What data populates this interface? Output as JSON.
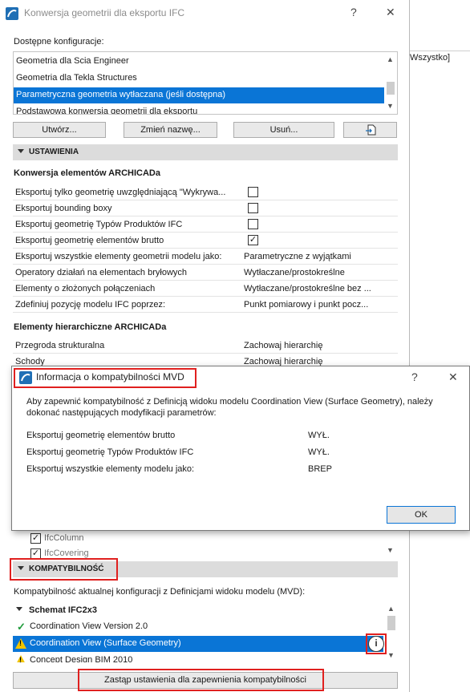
{
  "background": {
    "partial_text": "Wszystko]"
  },
  "window": {
    "title": "Konwersja geometrii dla eksportu IFC",
    "help_glyph": "?",
    "close_glyph": "✕"
  },
  "configs": {
    "label": "Dostępne konfiguracje:",
    "items": [
      "Geometria dla Scia Engineer",
      "Geometria dla Tekla Structures",
      "Parametryczna geometria wytłaczana (jeśli dostępna)",
      "Podstawowa konwersja geometrii dla eksportu"
    ],
    "selected_index": 2,
    "buttons": {
      "create": "Utwórz...",
      "rename": "Zmień nazwę...",
      "delete": "Usuń..."
    }
  },
  "settings": {
    "header": "USTAWIENIA",
    "conv_header": "Konwersja elementów ARCHICADa",
    "rows": [
      {
        "label": "Eksportuj tylko geometrię uwzględniającą \"Wykrywa...",
        "checked": false
      },
      {
        "label": "Eksportuj bounding boxy",
        "checked": false
      },
      {
        "label": "Eksportuj geometrię Typów Produktów IFC",
        "checked": false
      },
      {
        "label": "Eksportuj geometrię elementów brutto",
        "checked": true
      },
      {
        "label": "Eksportuj wszystkie elementy geometrii modelu jako:",
        "value": "Parametryczne z wyjątkami"
      },
      {
        "label": "Operatory działań na elementach bryłowych",
        "value": "Wytłaczane/prostokreślne"
      },
      {
        "label": "Elementy o złożonych połączeniach",
        "value": "Wytłaczane/prostokreślne bez ..."
      },
      {
        "label": "Zdefiniuj pozycję modelu IFC poprzez:",
        "value": "Punkt pomiarowy i punkt pocz..."
      }
    ],
    "hier_header": "Elementy hierarchiczne ARCHICADa",
    "hier_rows": [
      {
        "label": "Przegroda strukturalna",
        "value": "Zachowaj hierarchię"
      },
      {
        "label": "Schody",
        "value": "Zachowaj hierarchię"
      }
    ],
    "ifc_items": [
      "IfcColumn",
      "IfcCovering"
    ]
  },
  "dialog": {
    "title": "Informacja o kompatybilności MVD",
    "help_glyph": "?",
    "close_glyph": "✕",
    "message": "Aby zapewnić kompatybilność z Definicją widoku modelu Coordination View (Surface Geometry), należy dokonać następujących modyfikacji parametrów:",
    "items": [
      {
        "label": "Eksportuj geometrię elementów brutto",
        "value": "WYŁ."
      },
      {
        "label": "Eksportuj geometrię Typów Produktów IFC",
        "value": "WYŁ."
      },
      {
        "label": "Eksportuj wszystkie elementy modelu jako:",
        "value": "BREP"
      }
    ],
    "ok_label": "OK"
  },
  "compat": {
    "header": "KOMPATYBILNOŚĆ",
    "description": "Kompatybilność aktualnej konfiguracji z Definicjami widoku modelu (MVD):",
    "schema": "Schemat IFC2x3",
    "items": [
      {
        "label": "Coordination View Version 2.0",
        "status": "ok"
      },
      {
        "label": "Coordination View (Surface Geometry)",
        "status": "warning"
      },
      {
        "label": "Concept Design BIM 2010",
        "status": "warning"
      }
    ],
    "selected_index": 1,
    "info_glyph": "i",
    "replace_button": "Zastąp ustawienia dla zapewnienia kompatybilności"
  },
  "colors": {
    "accent": "#0a75d6",
    "highlight": "#e0201f",
    "section": "#dcdcdc"
  }
}
